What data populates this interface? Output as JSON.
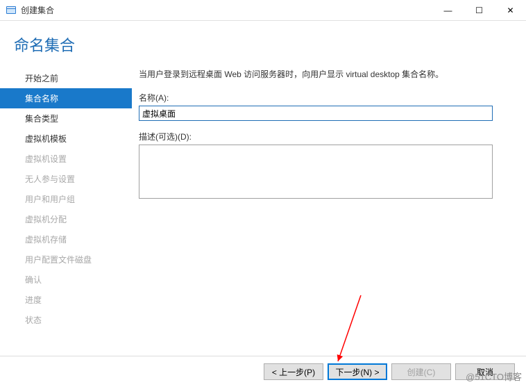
{
  "window": {
    "title": "创建集合",
    "minimize": "—",
    "maximize": "☐",
    "close": "✕"
  },
  "header": {
    "title": "命名集合"
  },
  "sidebar": {
    "steps": [
      {
        "label": "开始之前",
        "state": "done"
      },
      {
        "label": "集合名称",
        "state": "active"
      },
      {
        "label": "集合类型",
        "state": "done"
      },
      {
        "label": "虚拟机模板",
        "state": "done"
      },
      {
        "label": "虚拟机设置",
        "state": "disabled"
      },
      {
        "label": "无人参与设置",
        "state": "disabled"
      },
      {
        "label": "用户和用户组",
        "state": "disabled"
      },
      {
        "label": "虚拟机分配",
        "state": "disabled"
      },
      {
        "label": "虚拟机存储",
        "state": "disabled"
      },
      {
        "label": "用户配置文件磁盘",
        "state": "disabled"
      },
      {
        "label": "确认",
        "state": "disabled"
      },
      {
        "label": "进度",
        "state": "disabled"
      },
      {
        "label": "状态",
        "state": "disabled"
      }
    ]
  },
  "form": {
    "intro": "当用户登录到远程桌面 Web 访问服务器时，向用户显示 virtual desktop 集合名称。",
    "name_label": "名称(A):",
    "name_value": "虚拟桌面",
    "desc_label": "描述(可选)(D):",
    "desc_value": ""
  },
  "footer": {
    "prev": "< 上一步(P)",
    "next": "下一步(N) >",
    "create": "创建(C)",
    "cancel": "取消"
  },
  "watermark": "@51CTO博客"
}
